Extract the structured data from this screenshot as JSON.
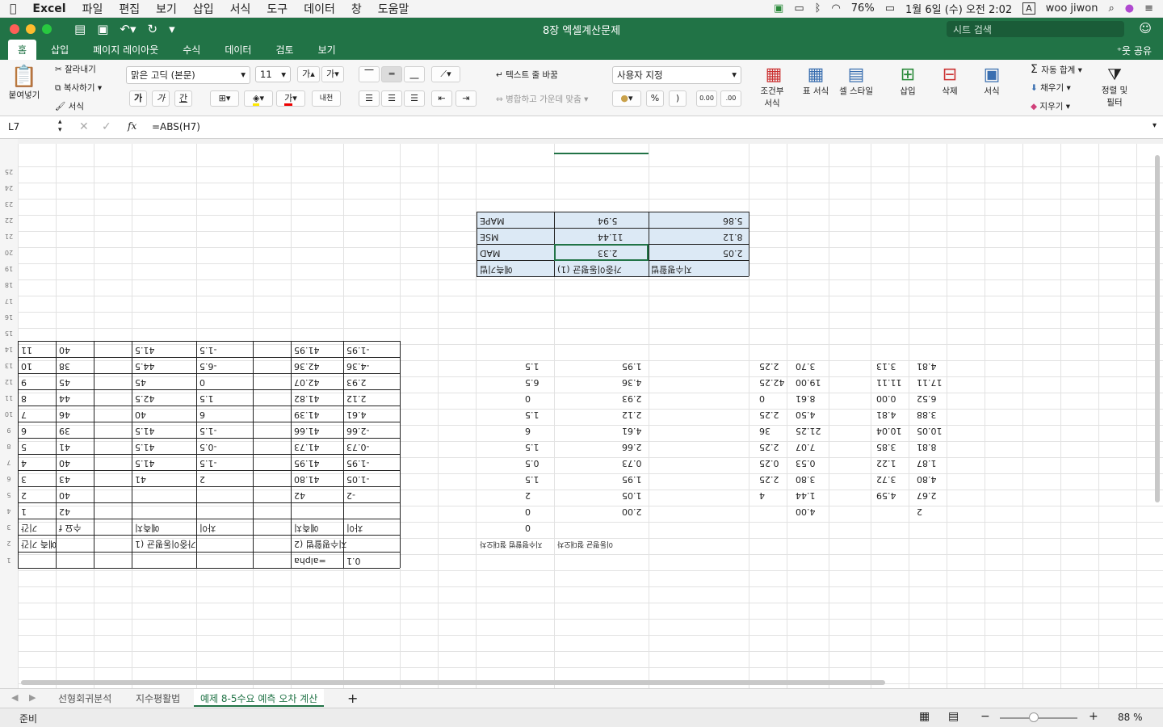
{
  "menubar": {
    "app": "Excel",
    "items": [
      "파일",
      "편집",
      "보기",
      "삽입",
      "서식",
      "도구",
      "데이터",
      "창",
      "도움말"
    ],
    "battery": "76%",
    "datetime": "1월 6일 (수) 오전 2:02",
    "input": "A",
    "user": "woo jiwon"
  },
  "titlebar": {
    "title": "8장 엑셀계산문제",
    "search_placeholder": "시트 검색"
  },
  "ribbon_tabs": [
    "홈",
    "삽입",
    "페이지 레이아웃",
    "수식",
    "데이터",
    "검토",
    "보기"
  ],
  "share": "공유",
  "ribbon": {
    "paste": "붙여넣기",
    "cut": "잘라내기",
    "copy": "복사하기",
    "format_painter": "서식",
    "font": "맑은 고딕 (본문)",
    "size": "11",
    "bold": "가",
    "italic": "가",
    "underline": "간",
    "wrap": "텍스트 줄 바꿈",
    "merge": "병합하고 가운데 맞춤",
    "numfmt": "사용자 지정",
    "cond": "조건부 서식",
    "table": "표 서식",
    "styles": "셀 스타일",
    "insert": "삽입",
    "delete": "삭제",
    "format": "서식",
    "autosum": "자동 합계",
    "fill": "채우기",
    "clear": "지우기",
    "sort": "정렬 및 필터",
    "grow": "가",
    "shrink": "가",
    "phonetic": "내천",
    "percent": "%",
    "comma": ")",
    "inc_dec": "0.00",
    "dec_dec": ".00"
  },
  "formula": {
    "cell": "L7",
    "fx": "fx",
    "value": "=ABS(H7)"
  },
  "sheet_tabs": [
    "선형회귀분석",
    "지수평활법",
    "예제 8-5수요 예측 오차 계산"
  ],
  "status": {
    "ready": "준비",
    "zoom": "88 %"
  },
  "grid": {
    "row_numbers": [
      "1",
      "2",
      "3",
      "4",
      "5",
      "6",
      "7",
      "8",
      "9",
      "10",
      "11",
      "12",
      "13",
      "14",
      "15",
      "16",
      "17",
      "18",
      "19",
      "20",
      "21",
      "22",
      "23",
      "24",
      "25"
    ],
    "left_table": {
      "alpha_label": "=alpha",
      "alpha": "0.1",
      "h1": "지수평활법 (2",
      "h2": "가중이동평균 (1",
      "h3": "예측 기간",
      "sub": [
        "차이",
        "예측치",
        "차이",
        "예측치",
        "수요 f",
        "기간"
      ],
      "rows": [
        [
          "",
          "",
          "",
          "",
          "42",
          "1"
        ],
        [
          "-2",
          "42",
          "",
          "",
          "40",
          "2"
        ],
        [
          "-1.05",
          "41.80",
          "2",
          "41",
          "43",
          "3"
        ],
        [
          "-1.95",
          "41.95",
          "-1.5",
          "41.5",
          "40",
          "4"
        ],
        [
          "-0.73",
          "41.73",
          "-0.5",
          "41.5",
          "41",
          "5"
        ],
        [
          "-2.66",
          "41.66",
          "-1.5",
          "41.5",
          "39",
          "6"
        ],
        [
          "4.61",
          "41.39",
          "6",
          "40",
          "46",
          "7"
        ],
        [
          "2.12",
          "41.82",
          "1.5",
          "42.5",
          "44",
          "8"
        ],
        [
          "2.93",
          "42.07",
          "0",
          "45",
          "45",
          "9"
        ],
        [
          "-4.36",
          "42.36",
          "-6.5",
          "44.5",
          "38",
          "10"
        ],
        [
          "-1.95",
          "41.95",
          "-1.5",
          "41.5",
          "40",
          "11"
        ]
      ]
    },
    "mid": {
      "h1": "지수평활법 절대오차",
      "h2": "이동평균 절대오차",
      "col_a": [
        "",
        "2.00",
        "1.05",
        "1.95",
        "0.73",
        "2.66",
        "4.61",
        "2.12",
        "2.93",
        "4.36",
        "1.95"
      ],
      "col_b": [
        "0",
        "0",
        "2",
        "1.5",
        "0.5",
        "1.5",
        "6",
        "1.5",
        "0",
        "6.5",
        "1.5"
      ],
      "col_c": [
        "",
        "4.00",
        "1.44",
        "3.80",
        "0.53",
        "7.07",
        "21.25",
        "4.50",
        "8.61",
        "19.00",
        "3.70"
      ],
      "col_d": [
        "",
        "",
        "4",
        "2.25",
        "0.25",
        "2.25",
        "36",
        "2.25",
        "0",
        "42.25",
        "2.25"
      ],
      "col_e": [
        "",
        "",
        "4.59",
        "3.72",
        "1.22",
        "3.85",
        "10.04",
        "4.81",
        "0.00",
        "11.11",
        "3.13"
      ],
      "col_f": [
        "",
        "2",
        "2.67",
        "4.80",
        "1.87",
        "8.81",
        "10.05",
        "3.88",
        "6.52",
        "17.11",
        "4.81"
      ]
    },
    "summary": {
      "labels": [
        "예측기법",
        "MAD",
        "MSE",
        "MAPE"
      ],
      "c1": [
        "가중이동평균 (1)",
        "2.33",
        "11.44",
        "5.94"
      ],
      "c2": [
        "지수평활법",
        "2.05",
        "8.12",
        "5.86"
      ]
    }
  }
}
